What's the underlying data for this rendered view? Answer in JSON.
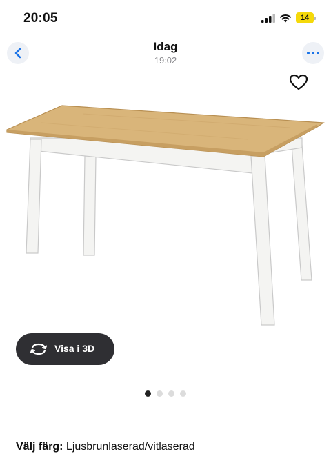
{
  "status_bar": {
    "time": "20:05",
    "battery": "14"
  },
  "nav": {
    "title": "Idag",
    "subtitle": "19:02"
  },
  "icons": {
    "back": "chevron-left-icon",
    "more": "ellipsis-icon",
    "favorite": "heart-icon",
    "rotate": "rotate-3d-icon"
  },
  "product": {
    "view_3d_label": "Visa i 3D"
  },
  "pager": {
    "count": 4,
    "active_index": 0
  },
  "color": {
    "label": "Välj färg:",
    "value": "Ljusbrunlaserad/vitlaserad"
  },
  "colors": {
    "accent": "#1a73e8",
    "button_dark": "#2f2f33",
    "battery": "#f5d90a",
    "table_top": "#d9b57a",
    "table_base": "#f4f4f2"
  }
}
